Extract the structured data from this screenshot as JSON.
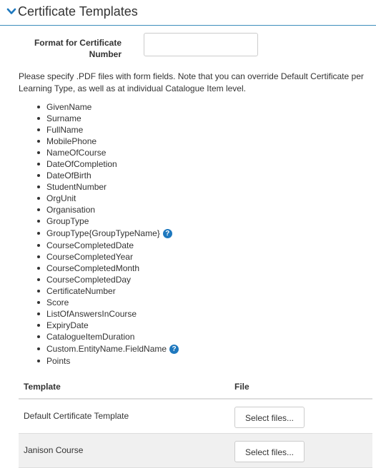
{
  "header": {
    "title": "Certificate Templates",
    "icon": "chevron-down-icon",
    "accent_color": "#1e78be"
  },
  "format": {
    "label": "Format for Certificate Number",
    "value": "",
    "placeholder": ""
  },
  "description": "Please specify .PDF files with form fields. Note that you can override Default Certificate per Learning Type, as well as at individual Catalogue Item level.",
  "fields": [
    {
      "label": "GivenName",
      "help": false
    },
    {
      "label": "Surname",
      "help": false
    },
    {
      "label": "FullName",
      "help": false
    },
    {
      "label": "MobilePhone",
      "help": false
    },
    {
      "label": "NameOfCourse",
      "help": false
    },
    {
      "label": "DateOfCompletion",
      "help": false
    },
    {
      "label": "DateOfBirth",
      "help": false
    },
    {
      "label": "StudentNumber",
      "help": false
    },
    {
      "label": "OrgUnit",
      "help": false
    },
    {
      "label": "Organisation",
      "help": false
    },
    {
      "label": "GroupType",
      "help": false
    },
    {
      "label": "GroupType{GroupTypeName}",
      "help": true
    },
    {
      "label": "CourseCompletedDate",
      "help": false
    },
    {
      "label": "CourseCompletedYear",
      "help": false
    },
    {
      "label": "CourseCompletedMonth",
      "help": false
    },
    {
      "label": "CourseCompletedDay",
      "help": false
    },
    {
      "label": "CertificateNumber",
      "help": false
    },
    {
      "label": "Score",
      "help": false
    },
    {
      "label": "ListOfAnswersInCourse",
      "help": false
    },
    {
      "label": "ExpiryDate",
      "help": false
    },
    {
      "label": "CatalogueItemDuration",
      "help": false
    },
    {
      "label": "Custom.EntityName.FieldName",
      "help": true
    },
    {
      "label": "Points",
      "help": false
    }
  ],
  "help_icon_glyph": "?",
  "table": {
    "columns": [
      "Template",
      "File"
    ],
    "rows": [
      {
        "template": "Default Certificate Template",
        "button": "Select files..."
      },
      {
        "template": "Janison Course",
        "button": "Select files..."
      }
    ]
  }
}
